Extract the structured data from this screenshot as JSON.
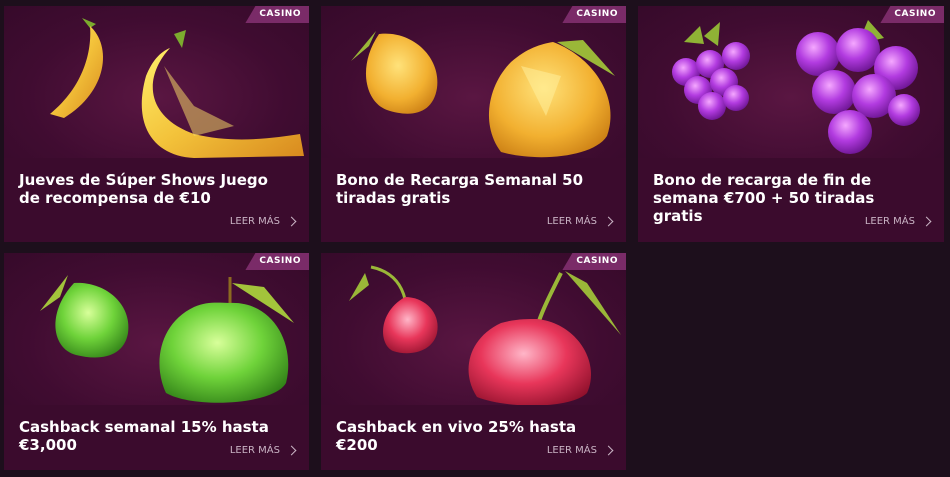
{
  "cards": [
    {
      "badge": "CASINO",
      "title": "Jueves de Súper Shows Juego de recompensa de €10",
      "more": "LEER MÁS",
      "fruit": "banana-icon"
    },
    {
      "badge": "CASINO",
      "title": "Bono de Recarga Semanal 50 tiradas gratis",
      "more": "LEER MÁS",
      "fruit": "lemon-icon"
    },
    {
      "badge": "CASINO",
      "title": "Bono de recarga de fin de semana €700 + 50 tiradas gratis",
      "more": "LEER MÁS",
      "fruit": "grapes-icon"
    },
    {
      "badge": "CASINO",
      "title": "Cashback semanal 15% hasta €3,000",
      "more": "LEER MÁS",
      "fruit": "apple-icon"
    },
    {
      "badge": "CASINO",
      "title": "Cashback en vivo 25% hasta €200",
      "more": "LEER MÁS",
      "fruit": "cherry-icon"
    }
  ]
}
